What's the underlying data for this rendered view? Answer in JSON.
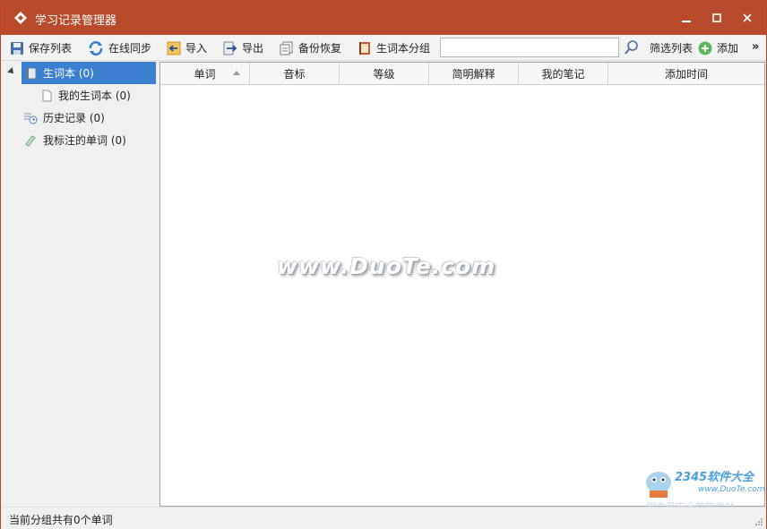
{
  "window": {
    "title": "学习记录管理器",
    "accent": "#b94a2b"
  },
  "toolbar": {
    "save_label": "保存列表",
    "sync_label": "在线同步",
    "import_label": "导入",
    "export_label": "导出",
    "backup_label": "备份恢复",
    "group_label": "生词本分组",
    "search_value": "",
    "filter_label": "筛选列表",
    "add_label": "添加",
    "more_label": "»"
  },
  "sidebar": {
    "items": [
      {
        "label": "生词本 (0)",
        "icon": "notebook-icon",
        "selected": true
      },
      {
        "label": "我的生词本 (0)",
        "icon": "document-icon",
        "selected": false
      },
      {
        "label": "历史记录 (0)",
        "icon": "history-icon",
        "selected": false
      },
      {
        "label": "我标注的单词 (0)",
        "icon": "tag-icon",
        "selected": false
      }
    ]
  },
  "table": {
    "columns": [
      "单词",
      "音标",
      "等级",
      "简明解释",
      "我的笔记",
      "添加时间"
    ],
    "sort_column": "单词",
    "rows": []
  },
  "watermark": {
    "text": "www.DuoTe.com"
  },
  "corner_logo": {
    "brand": "2345软件大全",
    "url": "www.DuoTe.com",
    "tagline": "国内最安全的软件站"
  },
  "status": {
    "text": "当前分组共有0个单词"
  }
}
